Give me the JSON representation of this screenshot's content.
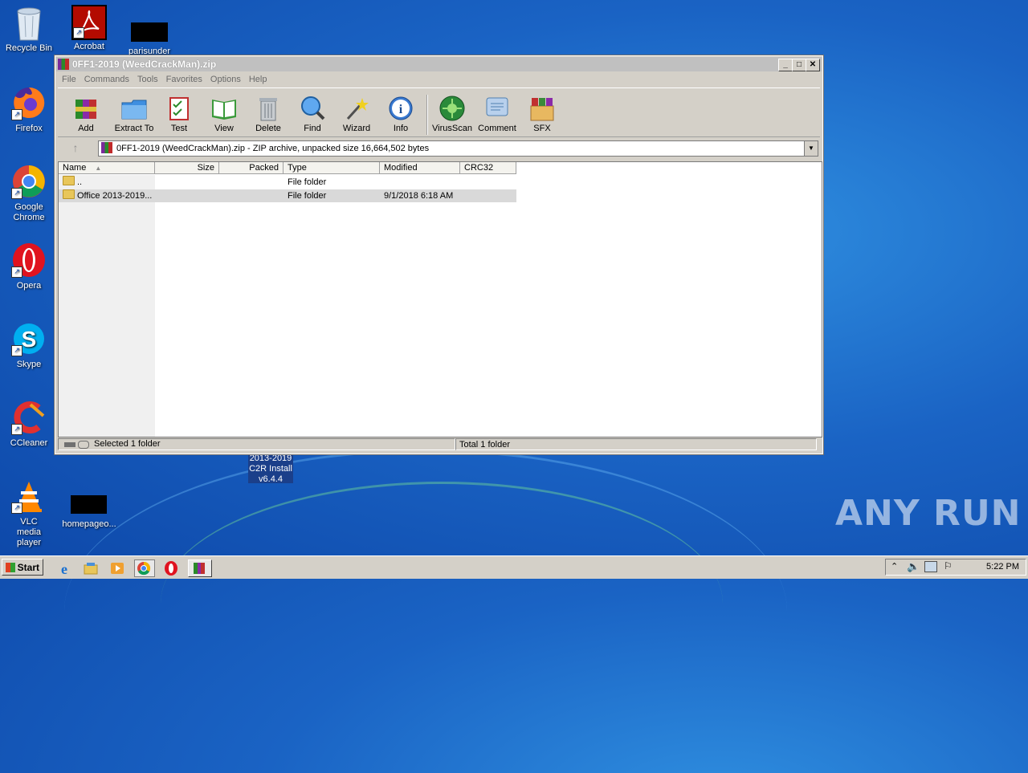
{
  "desktop": {
    "icons": [
      {
        "label": "Recycle Bin"
      },
      {
        "label": "Acrobat"
      },
      {
        "label": "parisunder"
      },
      {
        "label": "Firefox"
      },
      {
        "label": "Google Chrome"
      },
      {
        "label": "Opera"
      },
      {
        "label": "Skype"
      },
      {
        "label": "CCleaner"
      },
      {
        "label": "VLC media player"
      },
      {
        "label": "homepageo..."
      }
    ],
    "tooltip_lines": [
      "2013-2019",
      "C2R Install",
      "v6.4.4"
    ],
    "watermark": "ANY RUN"
  },
  "window": {
    "title": "0FF1-2019 (WeedCrackMan).zip",
    "menu": [
      "File",
      "Commands",
      "Tools",
      "Favorites",
      "Options",
      "Help"
    ],
    "toolbar": [
      {
        "label": "Add",
        "icon": "add-icon"
      },
      {
        "label": "Extract To",
        "icon": "extract-icon"
      },
      {
        "label": "Test",
        "icon": "test-icon"
      },
      {
        "label": "View",
        "icon": "view-icon"
      },
      {
        "label": "Delete",
        "icon": "delete-icon"
      },
      {
        "label": "Find",
        "icon": "find-icon"
      },
      {
        "label": "Wizard",
        "icon": "wizard-icon"
      },
      {
        "label": "Info",
        "icon": "info-icon"
      },
      {
        "label": "VirusScan",
        "icon": "virusscan-icon"
      },
      {
        "label": "Comment",
        "icon": "comment-icon"
      },
      {
        "label": "SFX",
        "icon": "sfx-icon"
      }
    ],
    "address": "0FF1-2019 (WeedCrackMan).zip - ZIP archive, unpacked size 16,664,502 bytes",
    "columns": [
      "Name",
      "Size",
      "Packed",
      "Type",
      "Modified",
      "CRC32"
    ],
    "rows": [
      {
        "name": "..",
        "size": "",
        "packed": "",
        "type": "File folder",
        "modified": "",
        "crc": ""
      },
      {
        "name": "Office 2013-2019...",
        "size": "",
        "packed": "",
        "type": "File folder",
        "modified": "9/1/2018 6:18 AM",
        "crc": ""
      }
    ],
    "status_left": "Selected 1 folder",
    "status_right": "Total 1 folder"
  },
  "taskbar": {
    "start_label": "Start",
    "clock": "5:22 PM"
  }
}
